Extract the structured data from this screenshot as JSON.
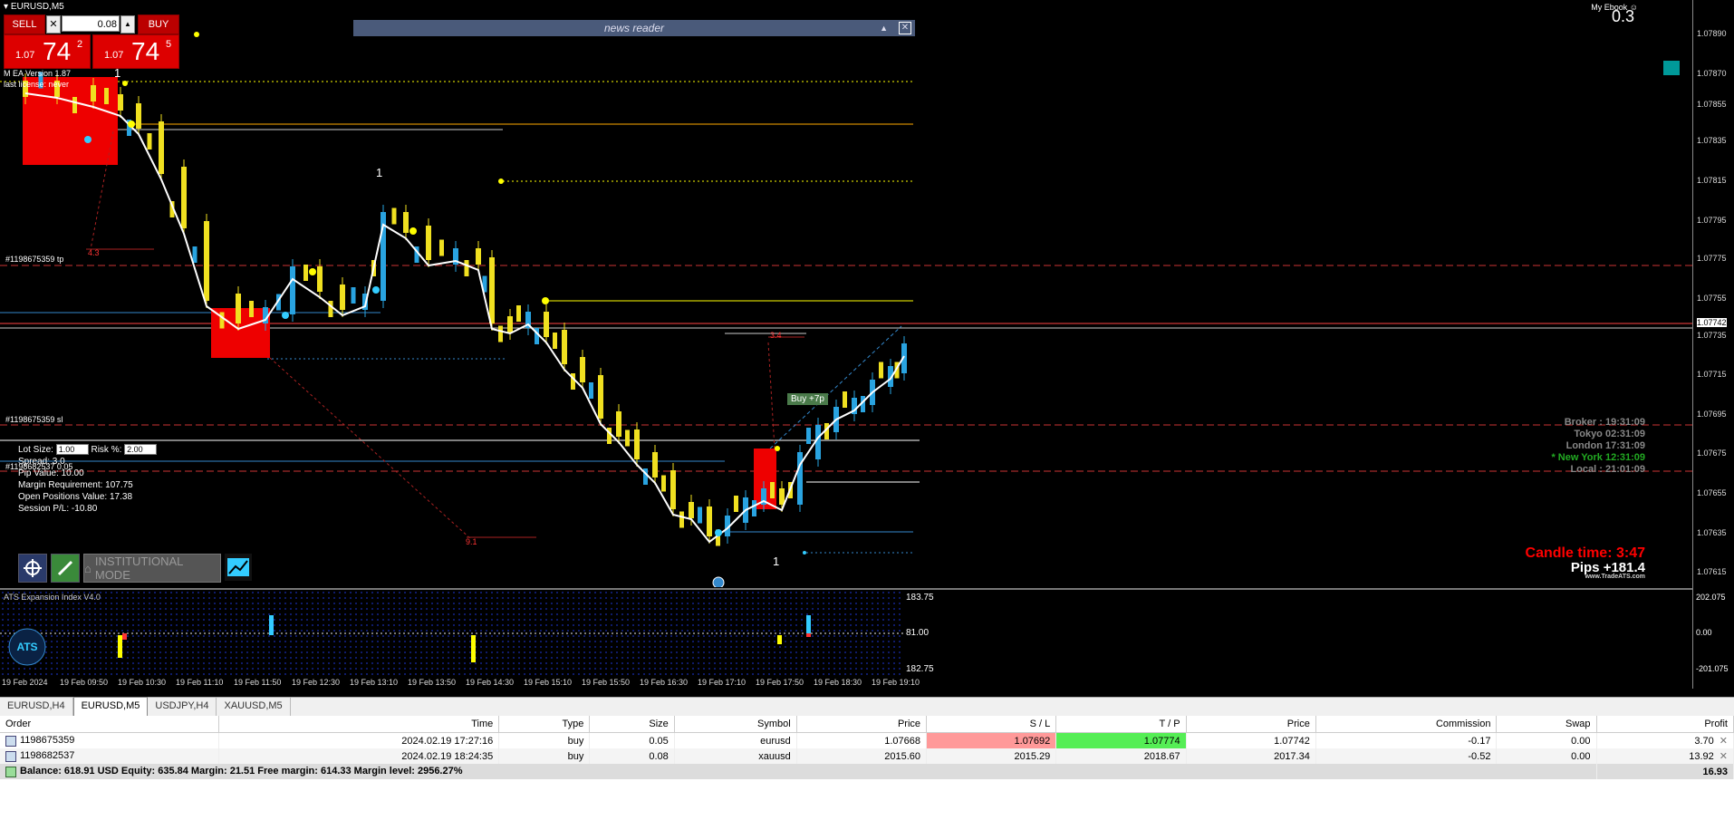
{
  "window": {
    "title": "EURUSD,M5"
  },
  "trade_panel": {
    "sell_label": "SELL",
    "buy_label": "BUY",
    "lot_value": "0.08",
    "sell_price_small": "1.07",
    "sell_price_big": "74",
    "sell_price_sup": "2",
    "buy_price_small": "1.07",
    "buy_price_big": "74",
    "buy_price_sup": "5"
  },
  "news_reader": {
    "title": "news reader"
  },
  "chart": {
    "ea_version": "M    EA  Version 1.87",
    "license": "last license: never",
    "top_right_label": "My Ebook",
    "top_right_value": "0.3",
    "tp_label": "#1198675359 tp",
    "sl_label": "#1198675359 sl",
    "order_label": "#1198682537  0.05",
    "buy_tag": "Buy +7p",
    "marker_1a": "1",
    "marker_1b": "1",
    "marker_1c": "1",
    "label_43": "4.3",
    "label_91": "9.1",
    "label_34": "3.4"
  },
  "price_scale": {
    "labels": [
      "1.07890",
      "1.07870",
      "1.07855",
      "1.07835",
      "1.07815",
      "1.07795",
      "1.07775",
      "1.07755",
      "1.07742",
      "1.07735",
      "1.07715",
      "1.07695",
      "1.07675",
      "1.07655",
      "1.07635",
      "1.07615"
    ],
    "current": "1.07742"
  },
  "info_panel": {
    "lot_size_label": "Lot Size:",
    "lot_size_value": "1.00",
    "risk_label": "Risk %:",
    "risk_value": "2.00",
    "spread": "Spread: 3.0",
    "pip_value": "Pip Value: 10.00",
    "margin_req": "Margin Requirement: 107.75",
    "open_pos": "Open Positions Value: 17.38",
    "session_pl": "Session P/L: -10.80"
  },
  "tool_buttons": {
    "institutional_mode": "INSTITUTIONAL MODE"
  },
  "clocks": [
    {
      "label": "Broker : 19:31:09",
      "color": "#888888"
    },
    {
      "label": "Tokyo  02:31:09",
      "color": "#888888"
    },
    {
      "label": "London  17:31:09",
      "color": "#888888"
    },
    {
      "label": "* New York  12:31:09",
      "color": "#22aa22"
    },
    {
      "label": "Local : 21:01:09",
      "color": "#888888"
    }
  ],
  "candle_time": "Candle time:  3:47",
  "pips": "Pips +181.4",
  "tradeats": "www.TradeATS.com",
  "indicator": {
    "title": "ATS Expansion Index V4.0",
    "left_values": [
      "183.75",
      "81.00",
      "182.75"
    ],
    "right_values": [
      "202.075",
      "0.00",
      "-201.075"
    ]
  },
  "time_axis": [
    "19 Feb 2024",
    "19 Feb 09:50",
    "19 Feb 10:30",
    "19 Feb 11:10",
    "19 Feb 11:50",
    "19 Feb 12:30",
    "19 Feb 13:10",
    "19 Feb 13:50",
    "19 Feb 14:30",
    "19 Feb 15:10",
    "19 Feb 15:50",
    "19 Feb 16:30",
    "19 Feb 17:10",
    "19 Feb 17:50",
    "19 Feb 18:30",
    "19 Feb 19:10"
  ],
  "chart_tabs": [
    "EURUSD,H4",
    "EURUSD,M5",
    "USDJPY,H4",
    "XAUUSD,M5"
  ],
  "active_tab": "EURUSD,M5",
  "terminal": {
    "headers": [
      "Order",
      "Time",
      "Type",
      "Size",
      "Symbol",
      "Price",
      "S / L",
      "T / P",
      "Price",
      "Commission",
      "Swap",
      "Profit"
    ],
    "rows": [
      [
        "1198675359",
        "2024.02.19 17:27:16",
        "buy",
        "0.05",
        "eurusd",
        "1.07668",
        "1.07692",
        "1.07774",
        "1.07742",
        "-0.17",
        "0.00",
        "3.70"
      ],
      [
        "1198682537",
        "2024.02.19 18:24:35",
        "buy",
        "0.08",
        "xauusd",
        "2015.60",
        "2015.29",
        "2018.67",
        "2017.34",
        "-0.52",
        "0.00",
        "13.92"
      ]
    ],
    "balance_line": "Balance: 618.91 USD  Equity: 635.84  Margin: 21.51  Free margin: 614.33  Margin level: 2956.27%",
    "total_profit": "16.93"
  }
}
